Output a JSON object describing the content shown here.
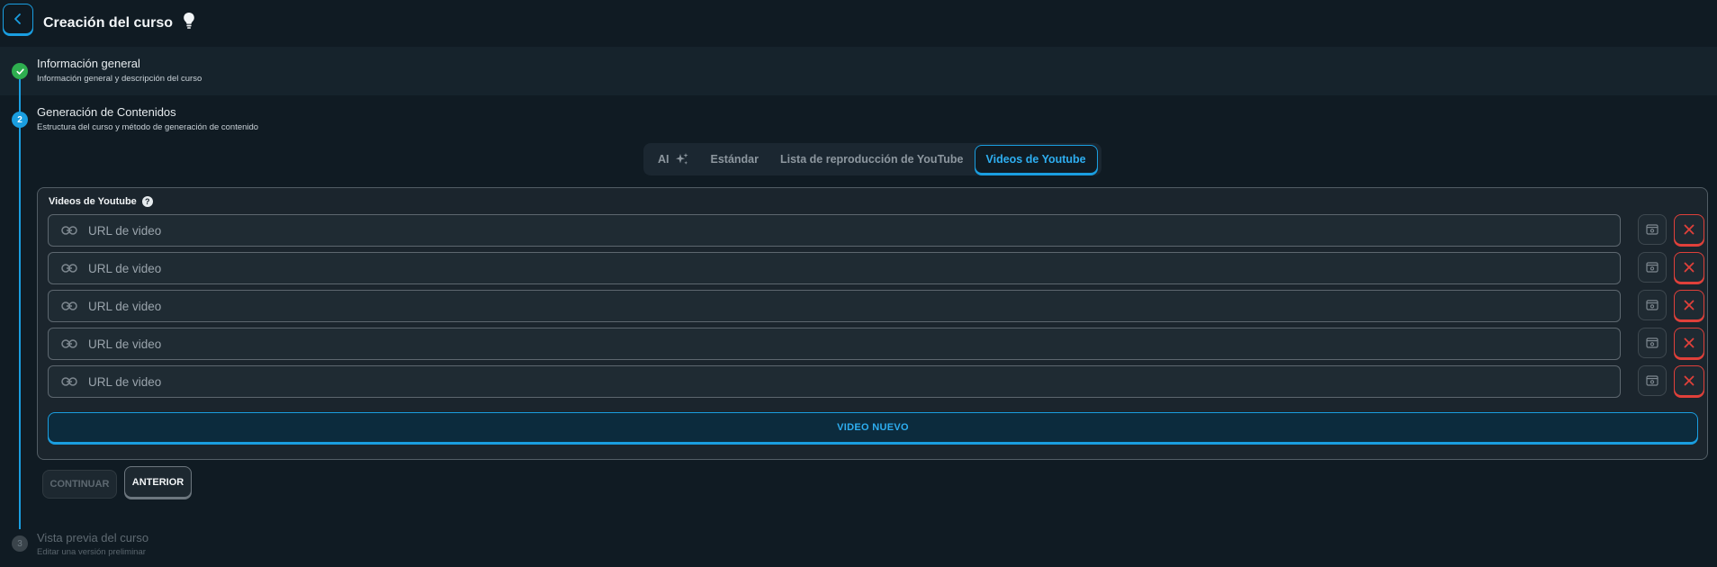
{
  "header": {
    "title": "Creación del curso",
    "back_icon": "chevron-left-icon",
    "idea_icon": "lightbulb-icon"
  },
  "steps": [
    {
      "number": "",
      "title": "Información general",
      "subtitle": "Información general y descripción del curso",
      "status": "completed"
    },
    {
      "number": "2",
      "title": "Generación de Contenidos",
      "subtitle": "Estructura del curso y método de generación de contenido",
      "status": "active"
    },
    {
      "number": "3",
      "title": "Vista previa del curso",
      "subtitle": "Editar una versión preliminar",
      "status": "pending"
    }
  ],
  "tabs": [
    {
      "label": "AI",
      "active": false
    },
    {
      "label": "Estándar",
      "active": false
    },
    {
      "label": "Lista de reproducción de YouTube",
      "active": false
    },
    {
      "label": "Videos de Youtube",
      "active": true
    }
  ],
  "panel": {
    "label": "Videos de Youtube",
    "help": "?",
    "url_placeholder": "URL de video",
    "urls": [
      {
        "value": "",
        "placeholder": "URL de video"
      },
      {
        "value": "",
        "placeholder": "URL de video"
      },
      {
        "value": "",
        "placeholder": "URL de video"
      },
      {
        "value": "",
        "placeholder": "URL de video"
      },
      {
        "value": "",
        "placeholder": "URL de video"
      }
    ],
    "new_video_label": "VIDEO NUEVO"
  },
  "actions": {
    "continue_label": "CONTINUAR",
    "continue_disabled": true,
    "previous_label": "ANTERIOR"
  },
  "colors": {
    "background": "#101b23",
    "accent": "#1a9ee0",
    "success": "#2eae4f",
    "danger": "#e0403a"
  }
}
